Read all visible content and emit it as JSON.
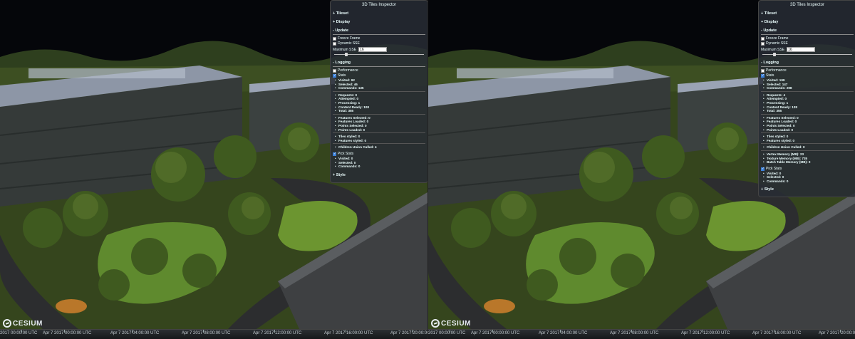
{
  "viewers": [
    {
      "inspector": {
        "title": "3D Tiles Inspector",
        "sections": {
          "tileset": "+ Tileset",
          "display": "+ Display",
          "update": "- Update",
          "logging": "- Logging",
          "style": "+ Style"
        },
        "update": {
          "freeze_frame": "Freeze Frame",
          "dynamic_sse": "Dynamic SSE",
          "max_sse_label": "Maximum SSE",
          "max_sse_value": "16",
          "slider_fraction": 0.12
        },
        "logging": {
          "performance": "Performance",
          "stats": "Stats",
          "pick_stats": "Pick Stats"
        },
        "stats_groups": [
          [
            "Visited: 92",
            "Selected: 46",
            "Commands: 135"
          ],
          [
            "Requests: 0",
            "Attempted: 0",
            "Processing: 1",
            "Content Ready: 108",
            "Total: 355"
          ],
          [
            "Features Selected: 0",
            "Features Loaded: 0",
            "Points Selected: 0",
            "Points Loaded: 0"
          ],
          [
            "Tiles styled: 0",
            "Features styled: 0"
          ],
          [
            "Children Union Culled: 4"
          ]
        ],
        "pick_groups": [
          [
            "Visited: 0",
            "Selected: 0",
            "Commands: 0"
          ]
        ]
      },
      "timeline": [
        "2017 00:00:00 UTC",
        "Apr 7 2017 00:00:00 UTC",
        "Apr 7 2017 04:00:00 UTC",
        "Apr 7 2017 08:00:00 UTC",
        "Apr 7 2017 12:00:00 UTC",
        "Apr 7 2017 16:00:00 UTC",
        "Apr 7 2017 20:00:00"
      ],
      "logo": "CESIUM"
    },
    {
      "inspector": {
        "title": "3D Tiles Inspector",
        "sections": {
          "tileset": "+ Tileset",
          "display": "+ Display",
          "update": "- Update",
          "logging": "- Logging",
          "style": "+ Style"
        },
        "update": {
          "freeze_frame": "Freeze Frame",
          "dynamic_sse": "Dynamic SSE",
          "max_sse_label": "Maximum SSE",
          "max_sse_value": "16",
          "slider_fraction": 0.12
        },
        "logging": {
          "performance": "Performance",
          "stats": "Stats",
          "pick_stats": "Pick Stats"
        },
        "stats_groups": [
          [
            "Visited: 199",
            "Selected: 147",
            "Commands: 298"
          ],
          [
            "Requests: 4",
            "Attempted: 0",
            "Processing: 1",
            "Content Ready: 138",
            "Total: 355"
          ],
          [
            "Features Selected: 0",
            "Features Loaded: 0",
            "Points Selected: 0",
            "Points Loaded: 0"
          ],
          [
            "Tiles styled: 0",
            "Features styled: 0"
          ],
          [
            "Children Union Culled: 0"
          ],
          [
            "Vertex Memory (MB): 23",
            "Texture Memory (MB): 735",
            "Batch Table Memory (MB): 0"
          ]
        ],
        "pick_groups": [
          [
            "Visited: 0",
            "Selected: 0",
            "Commands: 0"
          ]
        ]
      },
      "timeline": [
        "2017 00:00:00 UTC",
        "Apr 7 2017 00:00:00 UTC",
        "Apr 7 2017 04:00:00 UTC",
        "Apr 7 2017 08:00:00 UTC",
        "Apr 7 2017 12:00:00 UTC",
        "Apr 7 2017 16:00:00 UTC",
        "Apr 7 2017 20:00:00"
      ],
      "logo": "CESIUM"
    }
  ],
  "colors": {
    "sky": "#05060a",
    "grass": "#5f8a2e",
    "tree": "#3f5a1f",
    "building": "#3b4140",
    "roof": "#9aa3b4",
    "road": "#2c2d2f",
    "panel_bg": "#282c34"
  }
}
